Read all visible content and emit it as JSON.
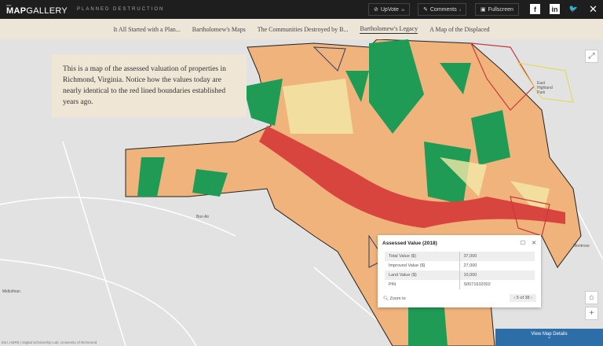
{
  "header": {
    "brand_small": "esri",
    "brand_bold": "MAP",
    "brand_light": "GALLERY",
    "subtitle": "PLANNED DESTRUCTION",
    "upvote": "UpVote",
    "upvote_count": "36",
    "comments": "Comments",
    "comments_count": "4",
    "fullscreen": "Fullscreen"
  },
  "nav": {
    "tabs": [
      "It All Started with a Plan...",
      "Bartholomew's Maps",
      "The Communities Destroyed by B...",
      "Bartholomew's Legacy",
      "A Map of the Displaced"
    ]
  },
  "caption": "This is a map of the assessed valuation of properties in Richmond, Virginia. Notice how the values today are nearly identical to the red lined boundaries established years ago.",
  "places": {
    "bon_air": "Bon Air",
    "midlothian": "Midlothian",
    "east_highland_park": "East Highland Park",
    "montrose": "Montrose"
  },
  "popup": {
    "title": "Assessed Value (2018)",
    "rows": [
      {
        "label": "Total Value ($)",
        "value": "37,000"
      },
      {
        "label": "Improved Value ($)",
        "value": "27,000"
      },
      {
        "label": "Land Value ($)",
        "value": "10,000"
      },
      {
        "label": "PIN",
        "value": "S0071632002"
      }
    ],
    "zoom_to": "Zoom to",
    "pager": "5 of 38"
  },
  "details": "View Map Details",
  "attribution": "Esri, HERE | Digital Scholarship Lab, University of Richmond",
  "colors": {
    "high": "#1f9b55",
    "low": "#e8735a",
    "river": "#d8453f",
    "mid": "#f3e9a8"
  }
}
